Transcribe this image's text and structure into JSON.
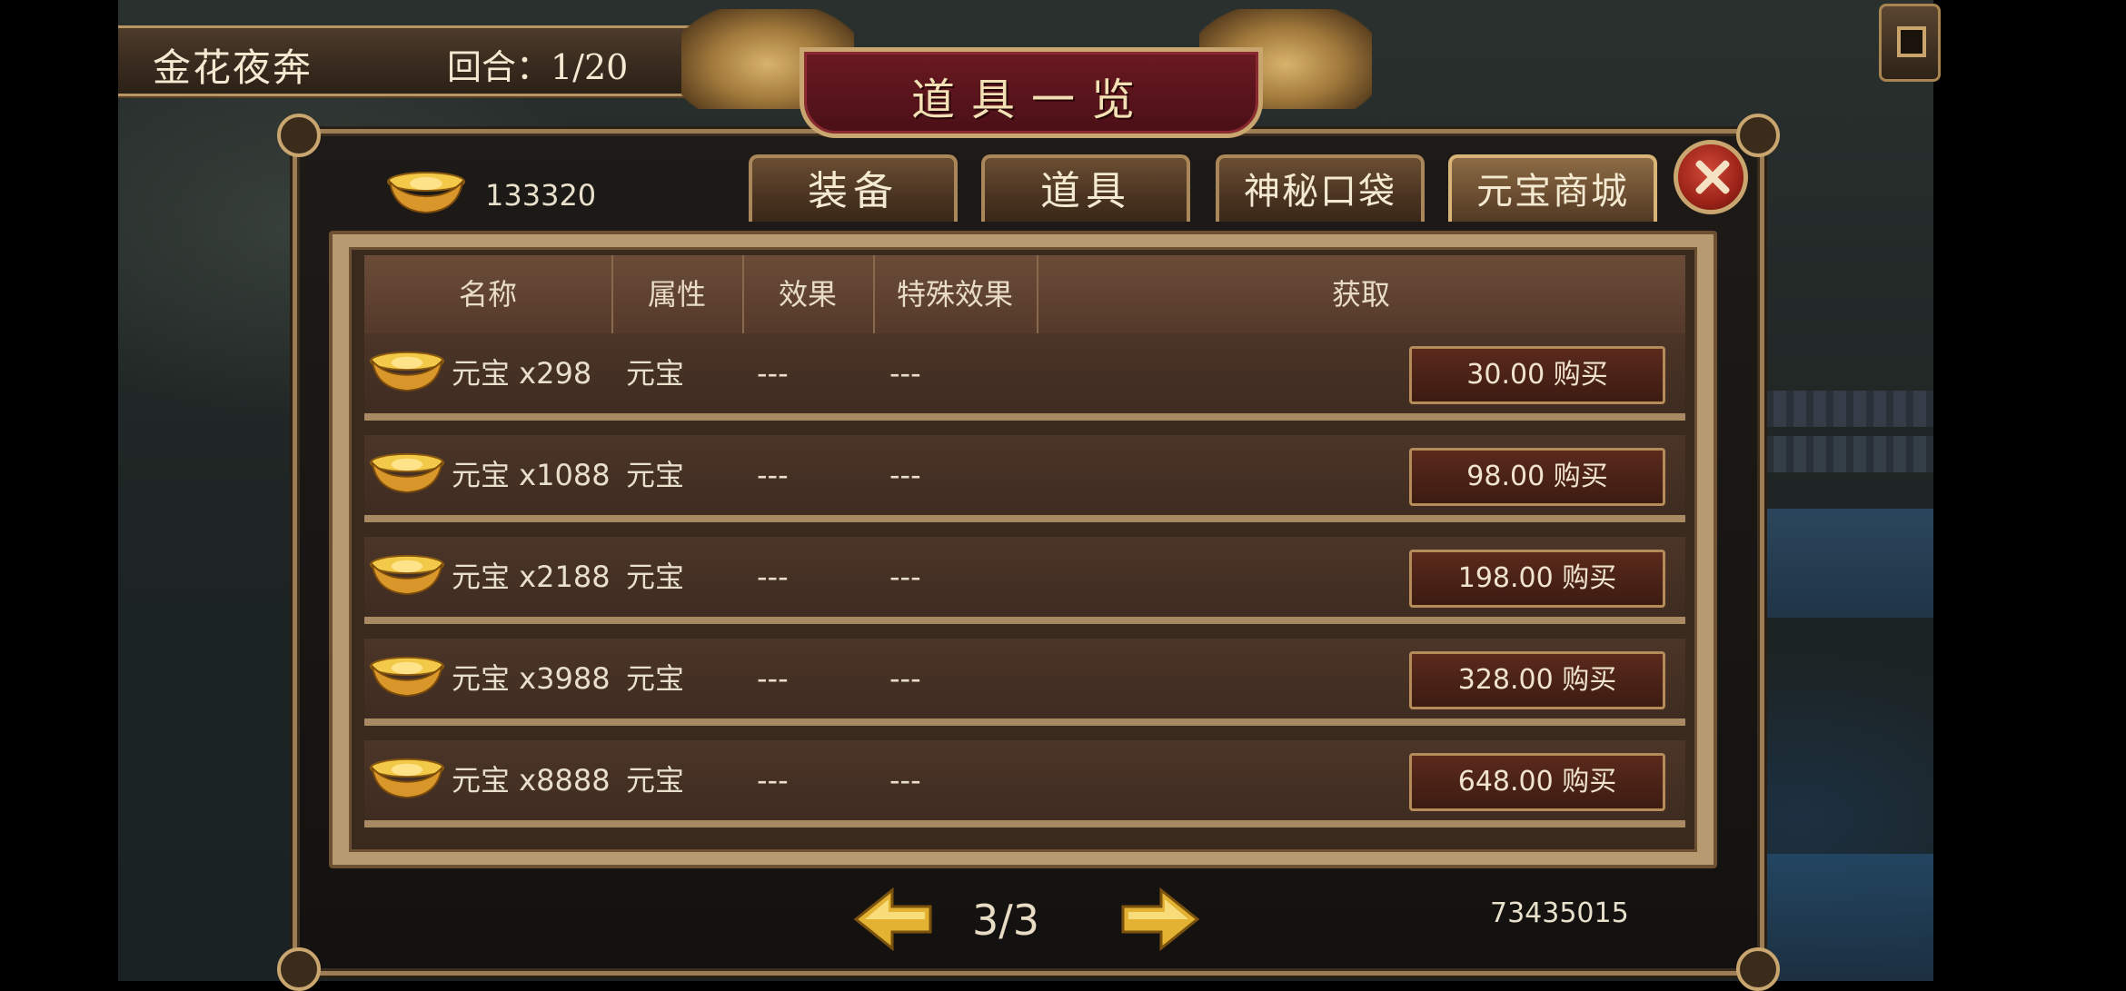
{
  "top_banner": {
    "stage_name": "金花夜奔",
    "round_label": "回合：1/20"
  },
  "panel": {
    "title": "道具一览"
  },
  "currency": {
    "value": "133320"
  },
  "tabs": [
    {
      "label": "装备",
      "active": false
    },
    {
      "label": "道具",
      "active": false
    },
    {
      "label": "神秘口袋",
      "active": false
    },
    {
      "label": "元宝商城",
      "active": true
    }
  ],
  "table": {
    "headers": [
      "名称",
      "属性",
      "效果",
      "特殊效果",
      "获取"
    ],
    "rows": [
      {
        "name": "元宝 x298",
        "attribute": "元宝",
        "effect": "---",
        "special": "---",
        "buy_label": "30.00 购买"
      },
      {
        "name": "元宝 x1088",
        "attribute": "元宝",
        "effect": "---",
        "special": "---",
        "buy_label": "98.00 购买"
      },
      {
        "name": "元宝 x2188",
        "attribute": "元宝",
        "effect": "---",
        "special": "---",
        "buy_label": "198.00 购买"
      },
      {
        "name": "元宝 x3988",
        "attribute": "元宝",
        "effect": "---",
        "special": "---",
        "buy_label": "328.00 购买"
      },
      {
        "name": "元宝 x8888",
        "attribute": "元宝",
        "effect": "---",
        "special": "---",
        "buy_label": "648.00 购买"
      }
    ]
  },
  "pager": {
    "page": "3/3"
  },
  "footer": {
    "id": "73435015"
  },
  "colors": {
    "gold": "#c9a66f",
    "panel_bg": "#1d1a17",
    "title_plate": "#6b1a22",
    "button_bg": "#4a2217"
  },
  "icons": {
    "currency": "gold-ingot-icon",
    "close": "close-icon",
    "prev": "arrow-left-icon",
    "next": "arrow-right-icon"
  }
}
